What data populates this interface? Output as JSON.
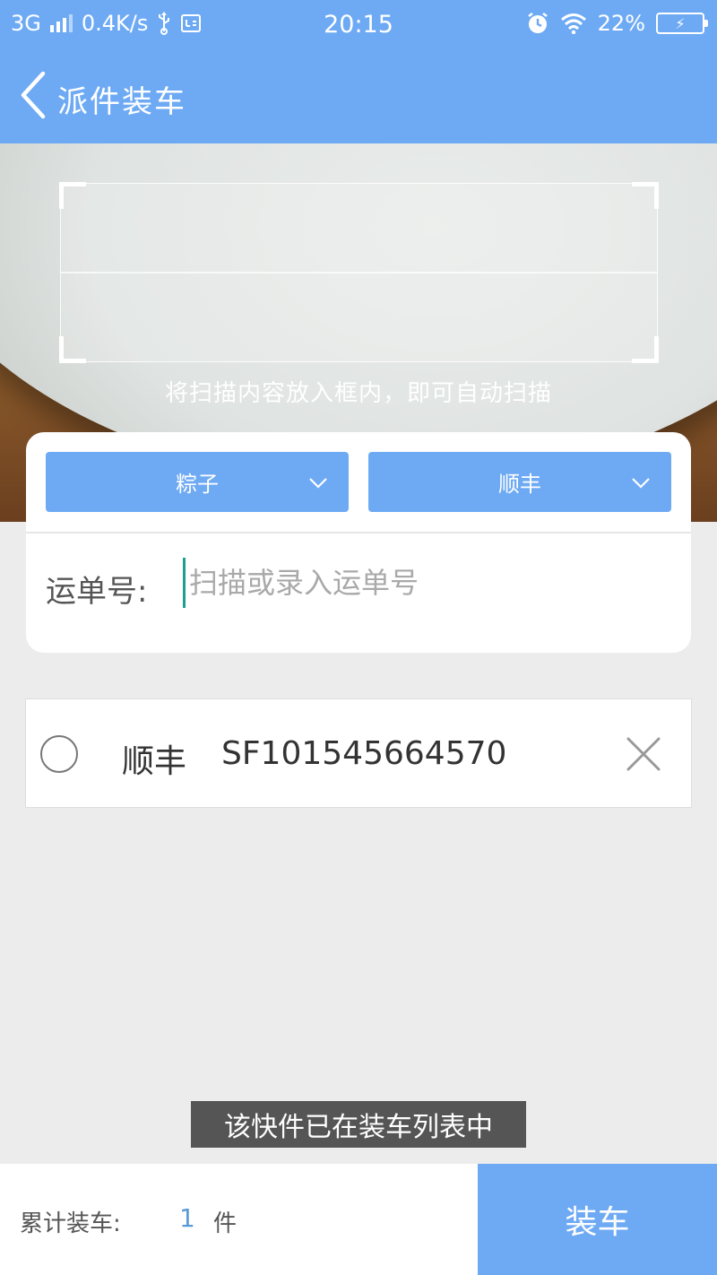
{
  "status_bar": {
    "network": "3G",
    "speed": "0.4K/s",
    "time": "20:15",
    "battery": "22%",
    "icons": [
      "signal-icon",
      "usb-icon",
      "usb-debug-icon",
      "alarm-icon",
      "wifi-icon",
      "battery-icon"
    ]
  },
  "header": {
    "title": "派件装车",
    "back_icon": "chevron-left-icon"
  },
  "scanner": {
    "hint": "将扫描内容放入框内，即可自动扫描"
  },
  "form": {
    "dropdown1_value": "粽子",
    "dropdown2_value": "顺丰",
    "waybill_label": "运单号:",
    "waybill_placeholder": "扫描或录入运单号",
    "waybill_value": ""
  },
  "items": [
    {
      "carrier": "顺丰",
      "waybill_no": "SF101545664570"
    }
  ],
  "toast": "该快件已在装车列表中",
  "footer": {
    "count_label": "累计装车:",
    "count_value": "1",
    "count_unit": "件",
    "load_button": "装车"
  },
  "colors": {
    "primary": "#6eaaf4",
    "count_value": "#5b9bd5",
    "cursor": "#1f9e8e",
    "toast_bg": "#555555"
  }
}
